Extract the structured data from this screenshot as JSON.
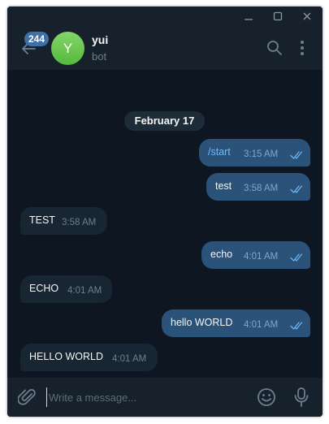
{
  "window_controls": {
    "minimize": "minimize-icon",
    "maximize": "maximize-icon",
    "close": "close-icon"
  },
  "header": {
    "unread_count": "244",
    "avatar_letter": "Y",
    "avatar_color": "#6ac554",
    "chat_name": "yui",
    "chat_status": "bot",
    "icons": [
      "back-arrow-icon",
      "search-icon",
      "more-vertical-icon"
    ]
  },
  "date_separator": "February 17",
  "messages": [
    {
      "direction": "outgoing",
      "text": "/start",
      "time": "3:15 AM",
      "status": "read"
    },
    {
      "direction": "outgoing",
      "text": "test",
      "time": "3:58 AM",
      "status": "read"
    },
    {
      "direction": "incoming",
      "text": "TEST",
      "time": "3:58 AM"
    },
    {
      "direction": "outgoing",
      "text": "echo",
      "time": "4:01 AM",
      "status": "read"
    },
    {
      "direction": "incoming",
      "text": "ECHO",
      "time": "4:01 AM"
    },
    {
      "direction": "outgoing",
      "text": "hello WORLD",
      "time": "4:01 AM",
      "status": "read"
    },
    {
      "direction": "incoming",
      "text": "HELLO WORLD",
      "time": "4:01 AM"
    }
  ],
  "composer": {
    "placeholder": "Write a message...",
    "value": "",
    "icons": [
      "paperclip-icon",
      "emoji-icon",
      "microphone-icon"
    ]
  },
  "colors": {
    "background": "#0e1621",
    "panel": "#17212b",
    "outgoing_bubble": "#2b5278",
    "incoming_bubble": "#182533",
    "link": "#71baf5",
    "read_ticks": "#69b4f1"
  }
}
